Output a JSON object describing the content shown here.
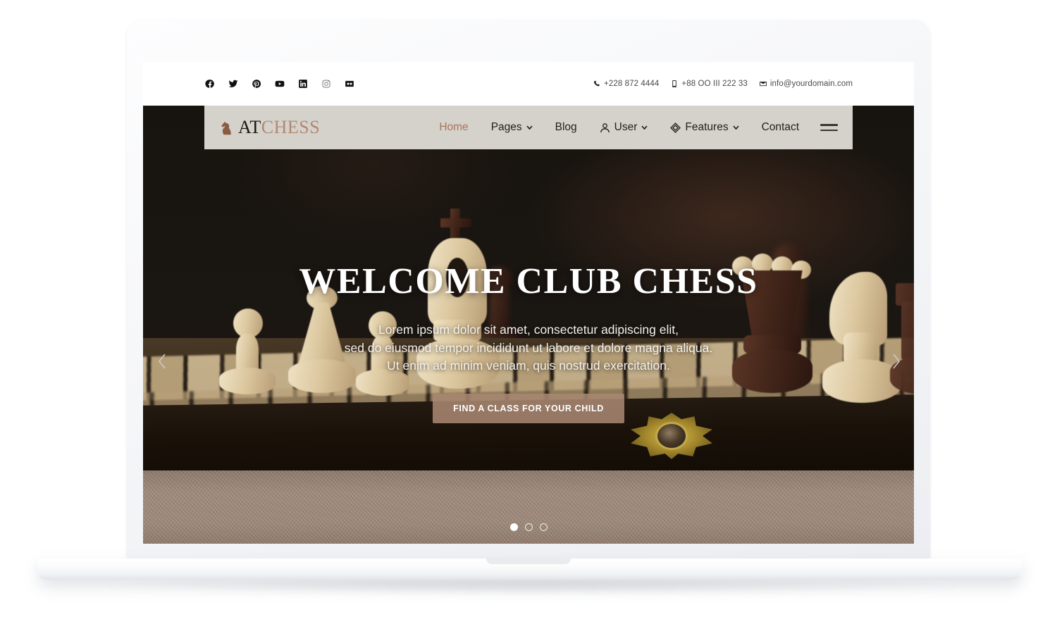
{
  "topbar": {
    "social": [
      {
        "name": "facebook-icon",
        "label": "Facebook"
      },
      {
        "name": "twitter-icon",
        "label": "Twitter"
      },
      {
        "name": "pinterest-icon",
        "label": "Pinterest"
      },
      {
        "name": "youtube-icon",
        "label": "YouTube"
      },
      {
        "name": "linkedin-icon",
        "label": "LinkedIn"
      },
      {
        "name": "instagram-icon",
        "label": "Instagram"
      },
      {
        "name": "flickr-icon",
        "label": "Flickr"
      }
    ],
    "contacts": [
      {
        "icon": "phone-icon",
        "text": "+228 872 4444"
      },
      {
        "icon": "mobile-icon",
        "text": "+88 OO III 222 33"
      },
      {
        "icon": "envelope-icon",
        "text": "info@yourdomain.com"
      }
    ]
  },
  "brand": {
    "icon": "chess-knight-icon",
    "at": "AT",
    "chess": "CHESS"
  },
  "nav": {
    "items": [
      {
        "label": "Home",
        "active": true,
        "caret": false,
        "glyph": null
      },
      {
        "label": "Pages",
        "active": false,
        "caret": true,
        "glyph": null
      },
      {
        "label": "Blog",
        "active": false,
        "caret": false,
        "glyph": null
      },
      {
        "label": "User",
        "active": false,
        "caret": true,
        "glyph": "user-icon"
      },
      {
        "label": "Features",
        "active": false,
        "caret": true,
        "glyph": "cube-icon"
      },
      {
        "label": "Contact",
        "active": false,
        "caret": false,
        "glyph": null
      }
    ],
    "menu_toggle": "hamburger-icon"
  },
  "hero": {
    "title": "WELCOME CLUB CHESS",
    "desc_line1": "Lorem ipsum dolor sit amet, consectetur adipiscing elit,",
    "desc_line2": "sed do eiusmod tempor incididunt ut labore et dolore magna aliqua.",
    "desc_line3": "Ut enim ad minim veniam, quis nostrud exercitation.",
    "cta_label": "FIND A CLASS FOR YOUR CHILD",
    "prev_icon": "chevron-left-icon",
    "next_icon": "chevron-right-icon",
    "slides": 3,
    "active_slide": 1,
    "background_alt": "Close-up photograph of a wooden chess set with light and dark pieces on a folding board"
  },
  "colors": {
    "accent": "#a8765a",
    "brand_chess": "#b08a72",
    "navbar_bg": "#d5d1cb",
    "cta_bg": "#a78671",
    "hero_bg": "#17130f"
  }
}
